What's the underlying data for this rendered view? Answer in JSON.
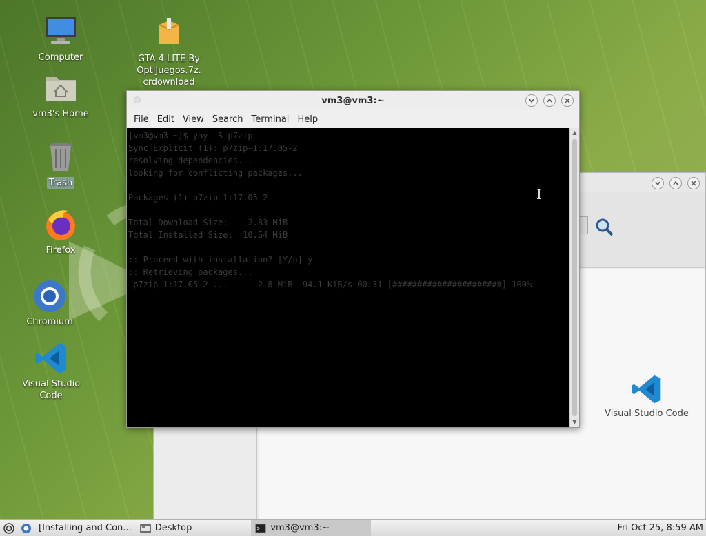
{
  "desktop": {
    "icons": [
      {
        "label": "Computer"
      },
      {
        "label": "GTA 4 LITE By OptiJuegos.7z.crdownload",
        "lines": [
          "GTA 4 LITE By",
          "OptiJuegos.7z.",
          "crdownload"
        ]
      },
      {
        "label": "vm3's Home"
      },
      {
        "label": "Trash"
      },
      {
        "label": "Firefox"
      },
      {
        "label": "Chromium"
      },
      {
        "label": "Visual Studio Code"
      }
    ]
  },
  "terminal": {
    "title": "vm3@vm3:~",
    "menu": [
      "File",
      "Edit",
      "View",
      "Search",
      "Terminal",
      "Help"
    ],
    "lines": [
      "[vm3@vm3 ~]$ yay -S p7zip",
      "Sync Explicit (1): p7zip-1:17.05-2",
      "resolving dependencies...",
      "looking for conflicting packages...",
      "",
      "Packages (1) p7zip-1:17.05-2",
      "",
      "Total Download Size:    2.83 MiB",
      "Total Installed Size:  10.54 MiB",
      "",
      ":: Proceed with installation? [Y/n] y",
      ":: Retrieving packages...",
      " p7zip-1:17.05-2-...      2.8 MiB  94.1 KiB/s 00:31 [######################] 100%"
    ]
  },
  "background_window": {
    "item_label": "Visual Studio Code"
  },
  "taskbar": {
    "items": [
      {
        "label": "[Installing and Con..."
      },
      {
        "label": "Desktop"
      },
      {
        "label": "vm3@vm3:~"
      }
    ],
    "clock": "Fri Oct 25,  8:59 AM"
  },
  "colors": {
    "terminal_bg": "#000000",
    "terminal_fg": "#3a3a3a",
    "vscode_blue": "#1f8ad2"
  }
}
